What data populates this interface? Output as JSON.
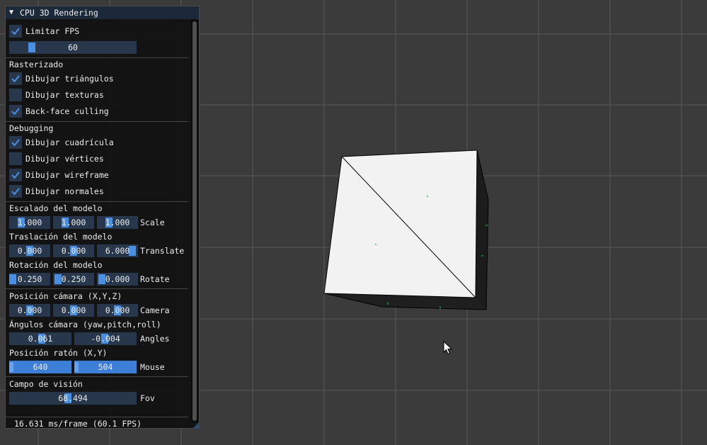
{
  "panel": {
    "title": "CPU 3D Rendering",
    "limit_fps": {
      "label": "Limitar FPS",
      "checked": true
    },
    "fps_slider": {
      "value": "60",
      "level": 0.17
    },
    "rasterizado": {
      "header": "Rasterizado",
      "items": [
        {
          "label": "Dibujar triángulos",
          "checked": true
        },
        {
          "label": "Dibujar texturas",
          "checked": false
        },
        {
          "label": "Back-face culling",
          "checked": true
        }
      ]
    },
    "debugging": {
      "header": "Debugging",
      "items": [
        {
          "label": "Dibujar cuadrícula",
          "checked": true
        },
        {
          "label": "Dibujar vértices",
          "checked": false
        },
        {
          "label": "Dibujar wireframe",
          "checked": true
        },
        {
          "label": "Dibujar normales",
          "checked": true
        }
      ]
    },
    "scale": {
      "header": "Escalado del modelo",
      "label": "Scale",
      "values": [
        "1.000",
        "1.000",
        "1.000"
      ]
    },
    "translate": {
      "header": "Traslación del modelo",
      "label": "Translate",
      "values": [
        "0.000",
        "0.000",
        "6.000"
      ]
    },
    "rotate": {
      "header": "Rotación del modelo",
      "label": "Rotate",
      "values": [
        "0.250",
        "0.250",
        "0.000"
      ]
    },
    "camera": {
      "header": "Posición cámara (X,Y,Z)",
      "label": "Camera",
      "values": [
        "0.000",
        "0.000",
        "0.000"
      ]
    },
    "angles": {
      "header": "Ángulos cámara (yaw,pitch,roll)",
      "label": "Angles",
      "values": [
        "0.061",
        "-0.004"
      ]
    },
    "mouse": {
      "header": "Posición ratón (X,Y)",
      "label": "Mouse",
      "values": [
        "640",
        "504"
      ]
    },
    "fov": {
      "header": "Campo de visión",
      "label": "Fov",
      "value": "68.494"
    },
    "footer": "16.631 ms/frame (60.1 FPS)"
  },
  "colors": {
    "viewport_bg": "#3b3b3b",
    "grid": "#5a5a5a",
    "panel_bg": "#121212",
    "frame_bg": "#29374c",
    "accent": "#4a90e2",
    "checkmark": "#4a90e2",
    "cube_face": "#f2f2f2",
    "cube_side": "#1c1c1c",
    "normal_marker": "#27b84a"
  }
}
